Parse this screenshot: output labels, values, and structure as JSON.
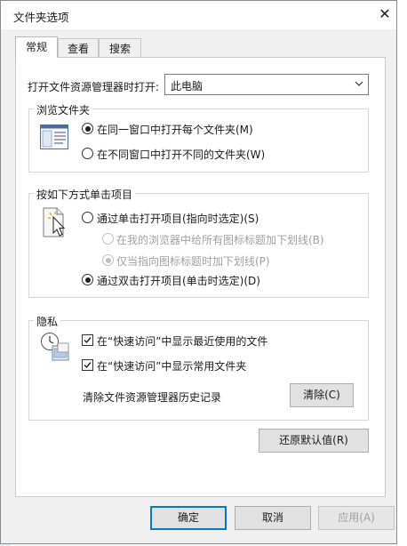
{
  "dialog": {
    "title": "文件夹选项",
    "close_glyph": "✕"
  },
  "tabs": [
    {
      "label": "常规",
      "active": true
    },
    {
      "label": "查看",
      "active": false
    },
    {
      "label": "搜索",
      "active": false
    }
  ],
  "general": {
    "open_explorer_label": "打开文件资源管理器时打开:",
    "open_explorer_value": "此电脑",
    "browse_group": {
      "title": "浏览文件夹",
      "options": [
        {
          "label": "在同一窗口中打开每个文件夹(M)",
          "selected": true
        },
        {
          "label": "在不同窗口中打开不同的文件夹(W)",
          "selected": false
        }
      ]
    },
    "click_group": {
      "title": "按如下方式单击项目",
      "single_click": {
        "label": "通过单击打开项目(指向时选定)(S)",
        "selected": false
      },
      "underline_always": {
        "label": "在我的浏览器中给所有图标标题加下划线(B)",
        "selected": false,
        "disabled": true
      },
      "underline_hover": {
        "label": "仅当指向图标标题时加下划线(P)",
        "selected": true,
        "disabled": true
      },
      "double_click": {
        "label": "通过双击打开项目(单击时选定)(D)",
        "selected": true
      }
    },
    "privacy_group": {
      "title": "隐私",
      "recent_files": {
        "label": "在“快速访问”中显示最近使用的文件",
        "checked": true
      },
      "frequent_folders": {
        "label": "在“快速访问”中显示常用文件夹",
        "checked": true
      },
      "clear_history_label": "清除文件资源管理器历史记录",
      "clear_button": "清除(C)"
    },
    "restore_defaults": "还原默认值(R)"
  },
  "footer": {
    "ok": "确定",
    "cancel": "取消",
    "apply": "应用(A)"
  },
  "colors": {
    "accent": "#0078d7",
    "dialog_bg": "#f0f0f0",
    "panel_bg": "#ffffff"
  }
}
